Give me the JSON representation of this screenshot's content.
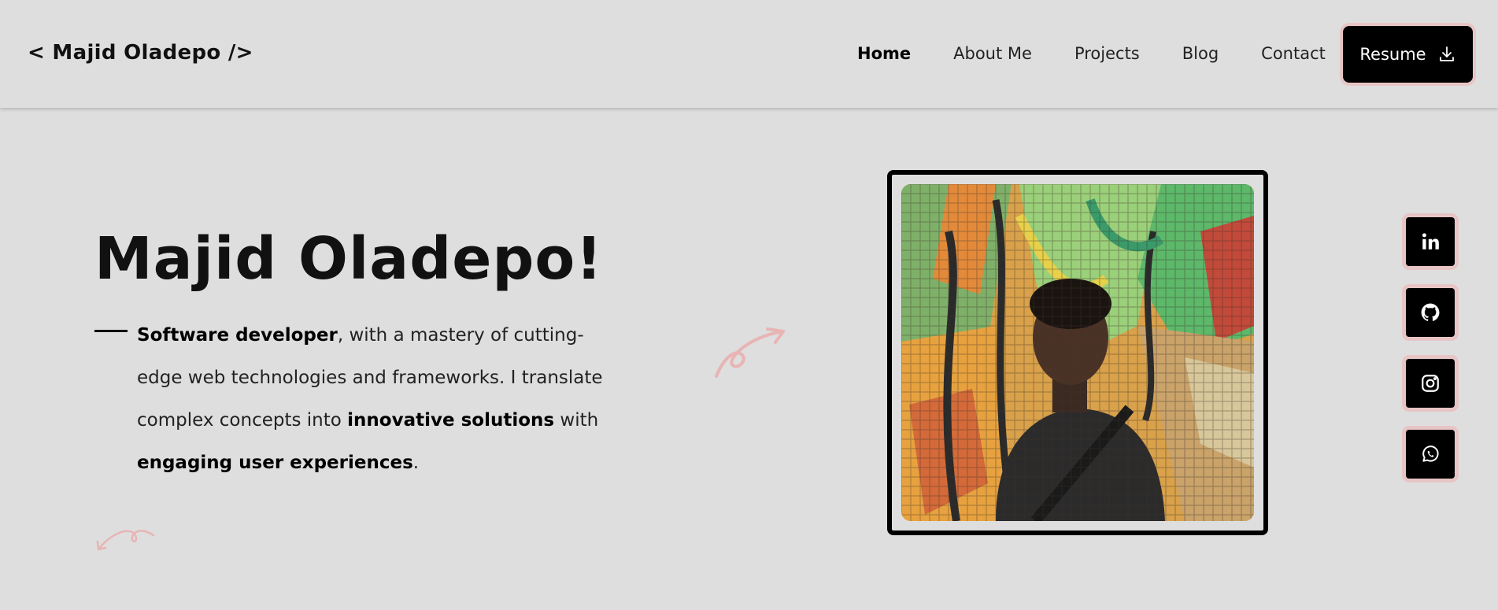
{
  "header": {
    "logo": "< Majid Oladepo />",
    "nav": [
      "Home",
      "About Me",
      "Projects",
      "Blog",
      "Contact"
    ],
    "active_nav": "Home",
    "resume_label": "Resume",
    "resume_icon": "download-icon"
  },
  "hero": {
    "title": "Majid Oladepo!",
    "bio": {
      "p1_bold": "Software developer",
      "p1": ", with a mastery of cutting-edge web technologies and frameworks. I translate complex concepts into ",
      "p2_bold": "innovative solutions",
      "p2": " with ",
      "p3_bold": "engaging user experiences",
      "p3": "."
    }
  },
  "socials": [
    {
      "name": "linkedin",
      "icon": "linkedin-icon"
    },
    {
      "name": "github",
      "icon": "github-icon"
    },
    {
      "name": "instagram",
      "icon": "instagram-icon"
    },
    {
      "name": "whatsapp",
      "icon": "whatsapp-icon"
    }
  ],
  "colors": {
    "background": "#dedede",
    "accent_pink": "#e8c5c5",
    "deco_pink": "#e8b4b4",
    "button": "#000000"
  }
}
